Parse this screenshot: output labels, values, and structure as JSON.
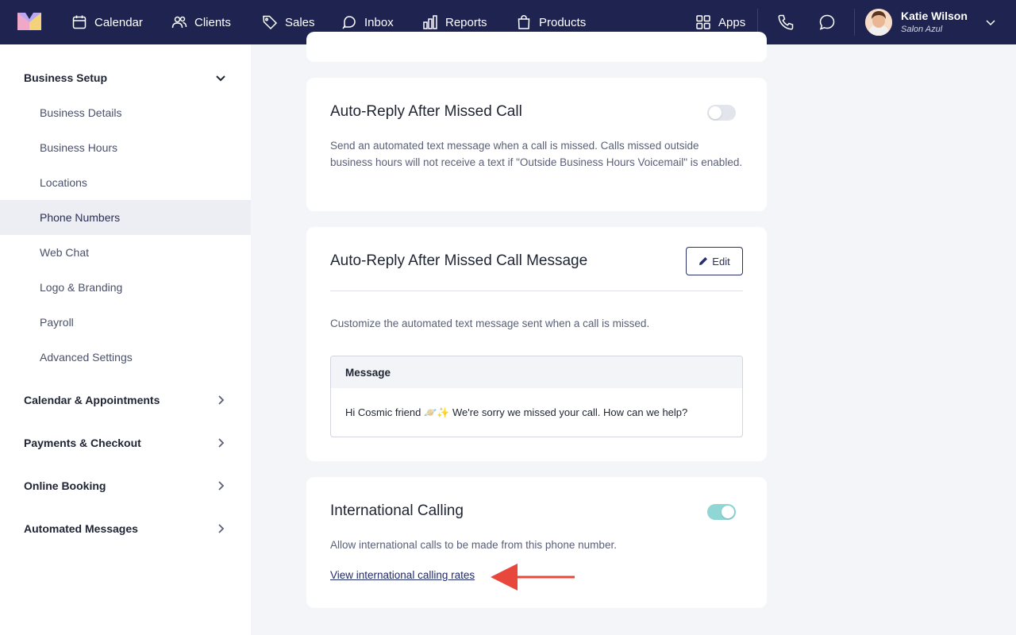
{
  "nav": {
    "items": [
      {
        "label": "Calendar",
        "icon": "calendar-icon"
      },
      {
        "label": "Clients",
        "icon": "users-icon"
      },
      {
        "label": "Sales",
        "icon": "tag-icon"
      },
      {
        "label": "Inbox",
        "icon": "inbox-icon"
      },
      {
        "label": "Reports",
        "icon": "bar-chart-icon"
      },
      {
        "label": "Products",
        "icon": "shopping-bag-icon"
      }
    ],
    "apps_label": "Apps",
    "user": {
      "name": "Katie Wilson",
      "business": "Salon Azul"
    },
    "colors": {
      "background": "#1e2350"
    }
  },
  "sidebar": {
    "business_setup": {
      "label": "Business Setup",
      "items": [
        {
          "label": "Business Details"
        },
        {
          "label": "Business Hours"
        },
        {
          "label": "Locations"
        },
        {
          "label": "Phone Numbers",
          "active": true
        },
        {
          "label": "Web Chat"
        },
        {
          "label": "Logo & Branding"
        },
        {
          "label": "Payroll"
        },
        {
          "label": "Advanced Settings"
        }
      ]
    },
    "sections": [
      {
        "label": "Calendar & Appointments"
      },
      {
        "label": "Payments & Checkout"
      },
      {
        "label": "Online Booking"
      },
      {
        "label": "Automated Messages"
      }
    ]
  },
  "cards": {
    "missed_call": {
      "title": "Auto-Reply After Missed Call",
      "description": "Send an automated text message when a call is missed. Calls missed outside business hours will not receive a text if \"Outside Business Hours Voicemail\" is enabled.",
      "enabled": false
    },
    "missed_call_message": {
      "title": "Auto-Reply After Missed Call Message",
      "edit_label": "Edit",
      "description": "Customize the automated text message sent when a call is missed.",
      "message_header": "Message",
      "message_text": "Hi Cosmic friend 🪐✨ We're sorry we missed your call. How can we help?"
    },
    "international": {
      "title": "International Calling",
      "description": "Allow international calls to be made from this phone number.",
      "link": "View international calling rates",
      "enabled": true
    }
  },
  "colors": {
    "accent": "#1e2350",
    "toggle_on": "#8fd6d4",
    "toggle_off": "#e3e5ec",
    "annotation_arrow": "#e8473c"
  }
}
